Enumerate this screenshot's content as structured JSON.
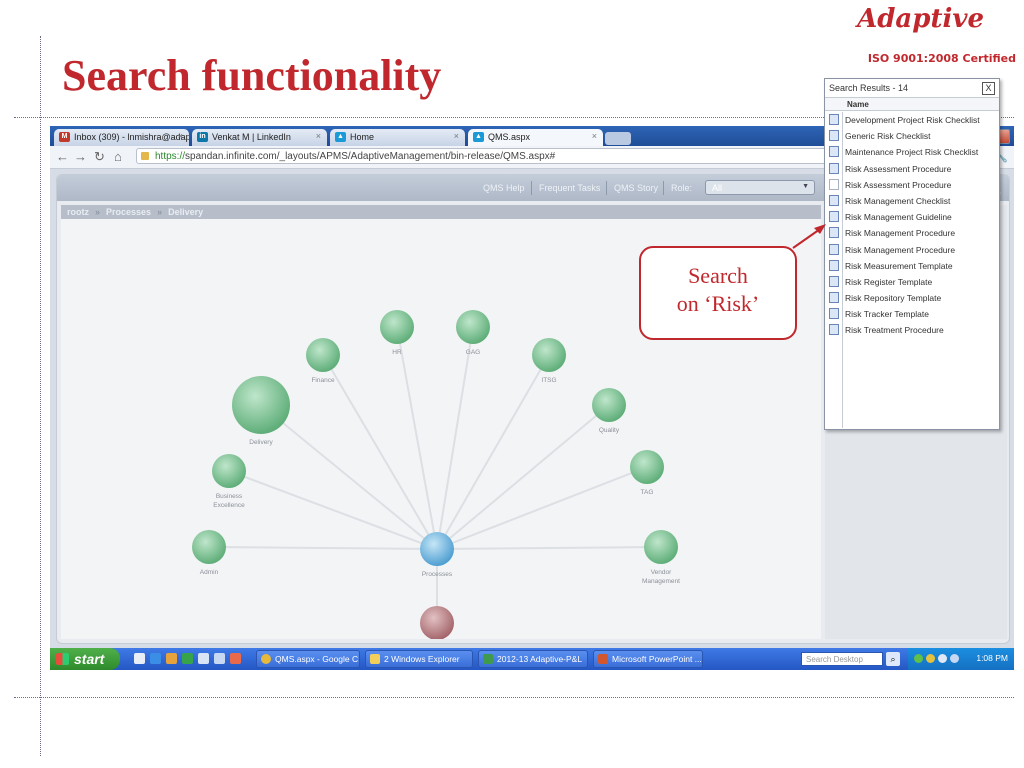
{
  "slide": {
    "title": "Search functionality",
    "brand": "Adaptive",
    "certification": "ISO 9001:2008 Certified"
  },
  "browser": {
    "tabs": [
      {
        "label": "Inbox (309) - lnmishra@adapt",
        "icon": "gmail-icon",
        "color": "#c0392b"
      },
      {
        "label": "Venkat M | LinkedIn",
        "icon": "linkedin-icon",
        "color": "#0e76a8"
      },
      {
        "label": "Home",
        "icon": "app-icon",
        "color": "#1a9ad6"
      },
      {
        "label": "QMS.aspx",
        "icon": "app-icon",
        "color": "#1a9ad6"
      }
    ],
    "url_scheme": "https://",
    "url_host": "spandan.infinite.com",
    "url_path": "/_layouts/APMS/AdaptiveManagement/bin-release/QMS.aspx#"
  },
  "app": {
    "toolbar_links": [
      "QMS Help",
      "Frequent Tasks",
      "QMS Story"
    ],
    "role_label": "Role:",
    "role_value": "All",
    "search_value": "risk",
    "breadcrumb": [
      "rootz",
      "Processes",
      "Delivery"
    ]
  },
  "graph": {
    "center": {
      "label": "Processes",
      "color": "#6ab6e2"
    },
    "root": {
      "label": "rootz",
      "color": "#b8787c"
    },
    "nodes": [
      {
        "label": "Finance"
      },
      {
        "label": "HR"
      },
      {
        "label": "GAG"
      },
      {
        "label": "ITSG"
      },
      {
        "label": "Quality"
      },
      {
        "label": "Delivery"
      },
      {
        "label": "TAG"
      },
      {
        "label": "Business Excellence"
      },
      {
        "label": "Admin"
      },
      {
        "label": "Vendor Management"
      }
    ],
    "node_color": "#7dc493"
  },
  "search_results": {
    "header": "Search Results - 14",
    "close_label": "X",
    "column": "Name",
    "items": [
      "Development Project Risk Checklist",
      "Generic Risk Checklist",
      "Maintenance Project Risk Checklist",
      "Risk Assessment Procedure",
      "Risk Assessment Procedure",
      "Risk Management Checklist",
      "Risk Management Guideline",
      "Risk Management Procedure",
      "Risk Management Procedure",
      "Risk Measurement Template",
      "Risk Register Template",
      "Risk Repository Template",
      "Risk Tracker Template",
      "Risk Treatment Procedure"
    ]
  },
  "callout": {
    "line1": "Search",
    "line2": "on ‘Risk’"
  },
  "taskbar": {
    "start": "start",
    "tasks": [
      "QMS.aspx - Google C...",
      "2 Windows Explorer",
      "2012-13 Adaptive-P&L",
      "Microsoft PowerPoint ..."
    ],
    "search_placeholder": "Search Desktop",
    "clock": "1:08 PM"
  },
  "colors": {
    "accent_red": "#c0282d",
    "taskbar_blue": "#2457c4"
  }
}
